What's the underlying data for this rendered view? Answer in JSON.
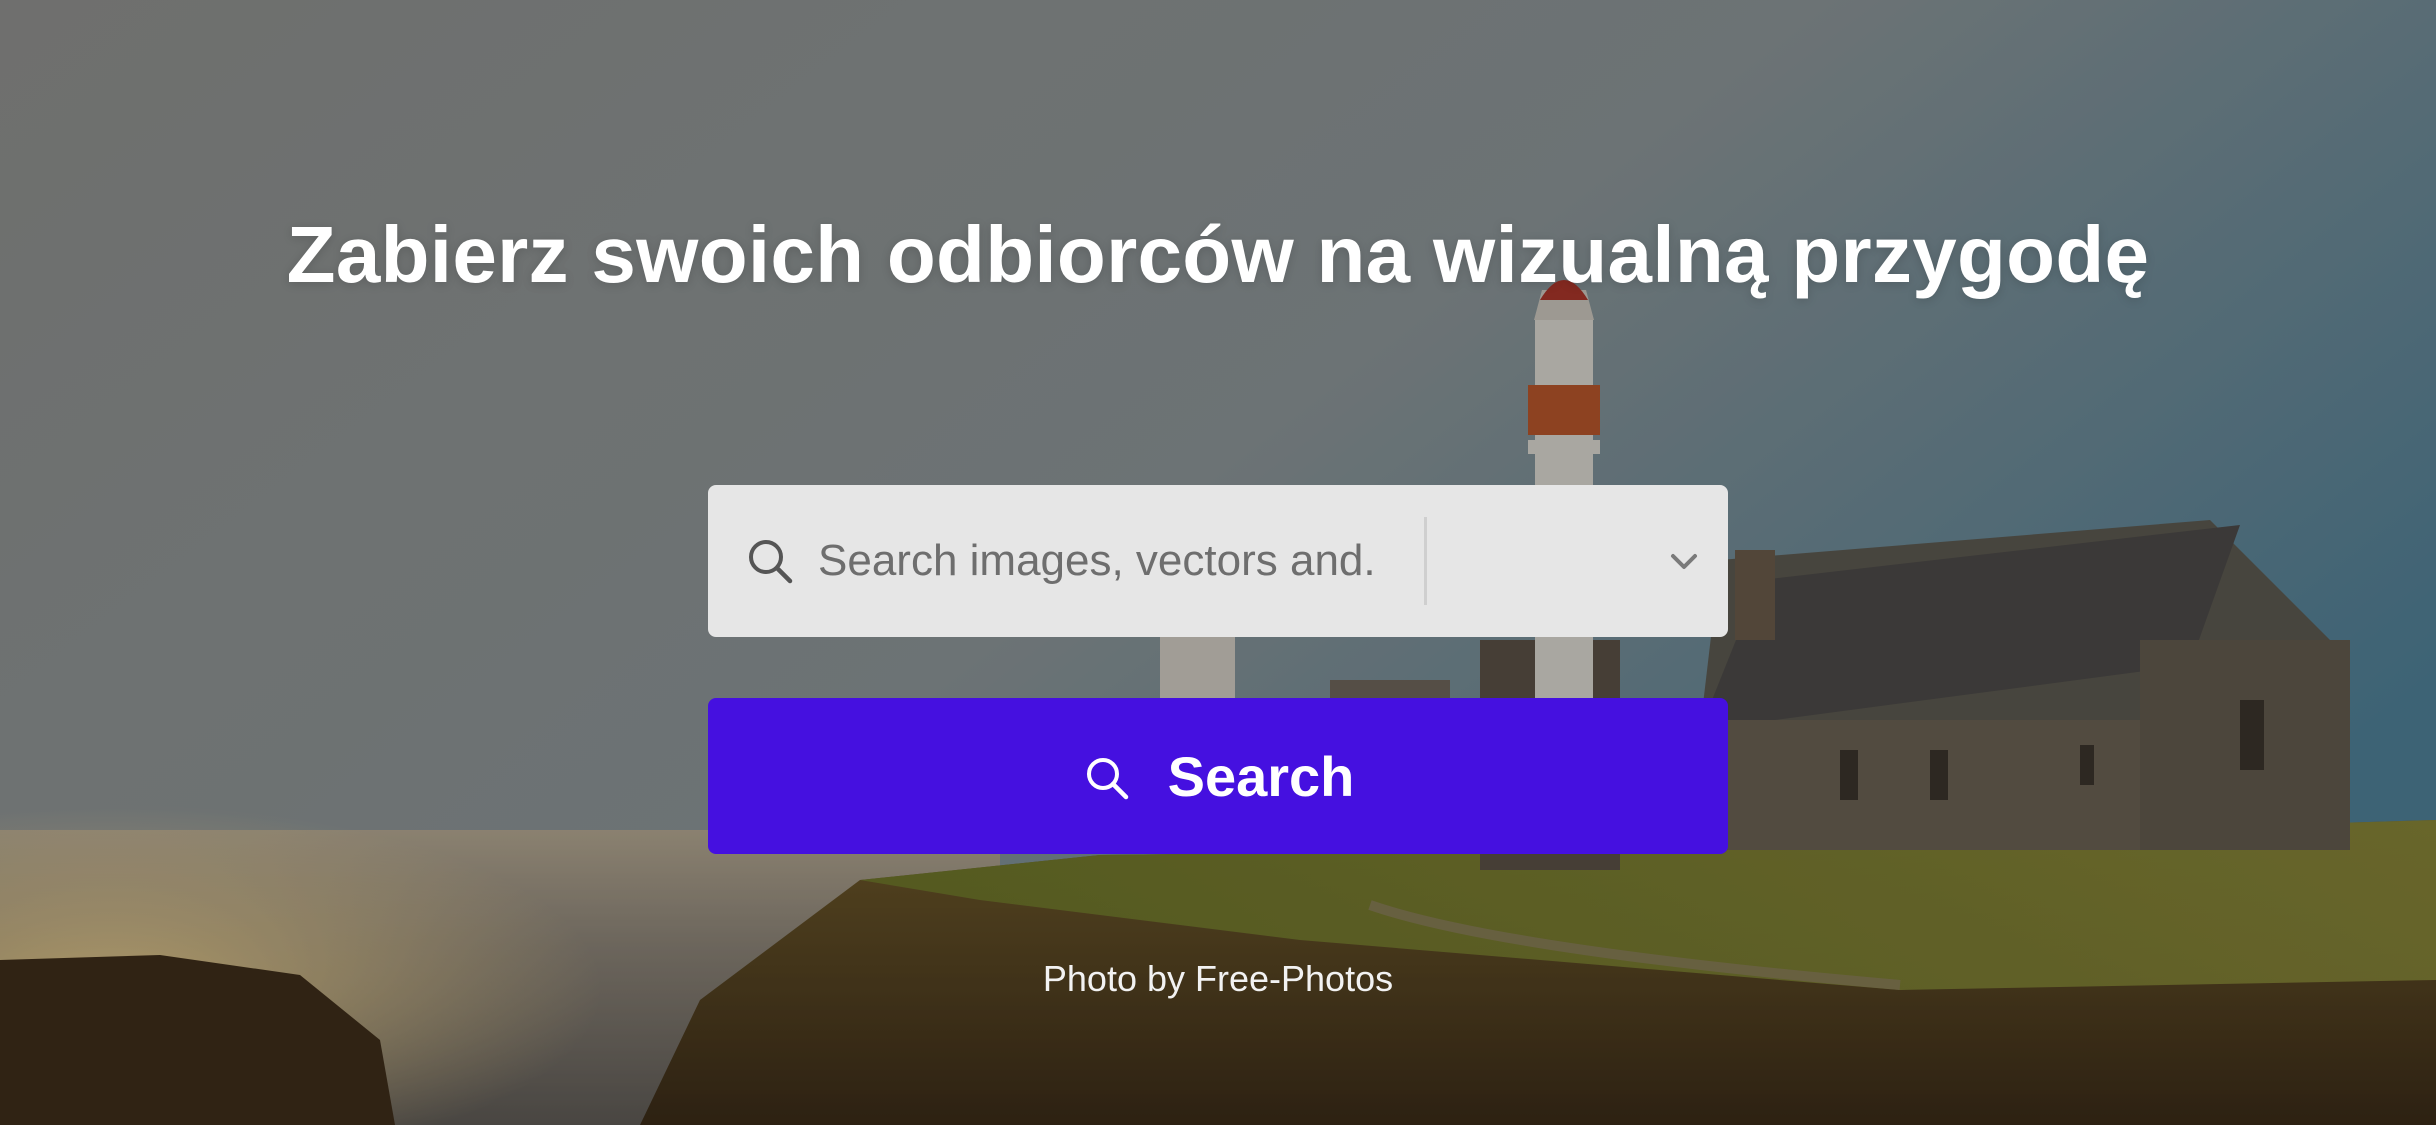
{
  "hero": {
    "headline": "Zabierz swoich odbiorców na wizualną przygodę",
    "background_description": "lighthouse"
  },
  "search": {
    "placeholder": "Search images, vectors and...",
    "value": "",
    "icon": "search-icon",
    "type_select": {
      "value": "",
      "icon": "chevron-down-icon"
    }
  },
  "search_button": {
    "label": "Search",
    "icon": "search-icon"
  },
  "credit": {
    "prefix": "Photo by ",
    "author": "Free-Photos"
  },
  "colors": {
    "accent": "#4510e0",
    "search_box_bg": "#e6e6e6",
    "headline_text": "#ffffff"
  }
}
